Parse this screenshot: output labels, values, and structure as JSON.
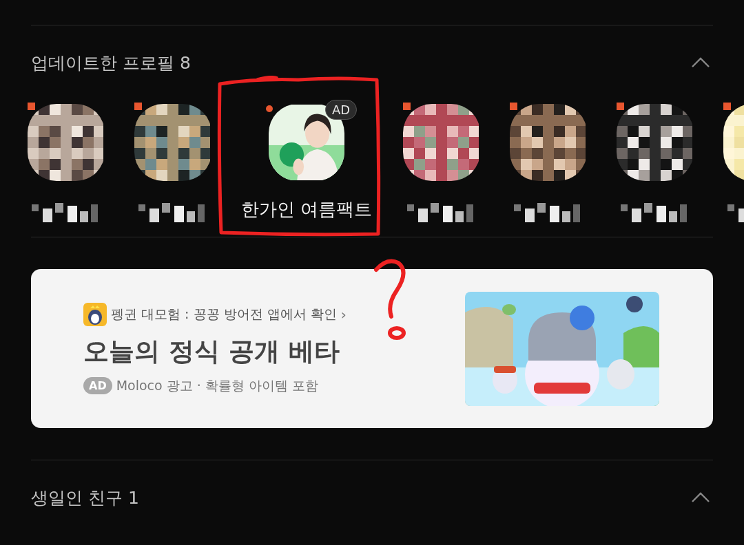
{
  "updated_section": {
    "title": "업데이트한 프로필 8",
    "expanded": true
  },
  "profiles": [
    {
      "kind": "friend",
      "new": true
    },
    {
      "kind": "friend",
      "new": true
    },
    {
      "kind": "ad",
      "new": true,
      "badge": "AD",
      "name": "한가인 여름팩트"
    },
    {
      "kind": "friend",
      "new": true
    },
    {
      "kind": "friend",
      "new": true
    },
    {
      "kind": "friend",
      "new": true
    },
    {
      "kind": "friend",
      "new": true
    }
  ],
  "ad_card": {
    "app_line": "펭귄 대모험 : 꽁꽁 방어전 앱에서 확인",
    "arrow": "›",
    "headline": "오늘의 정식 공개 베타",
    "badge": "AD",
    "meta": "Moloco 광고 · 확률형 아이템 포함"
  },
  "birthday_section": {
    "title": "생일인 친구 1",
    "expanded": true
  },
  "annotation": {
    "outline": true,
    "question_mark": true
  }
}
